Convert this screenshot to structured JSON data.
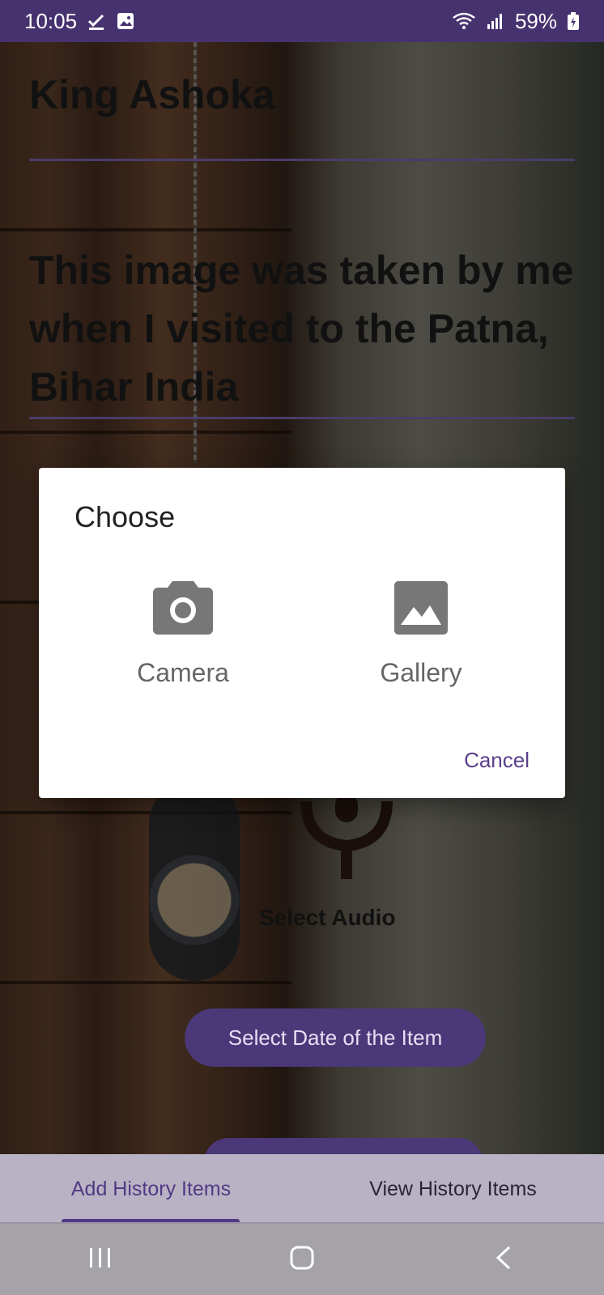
{
  "status_bar": {
    "time": "10:05",
    "battery": "59%",
    "icons": [
      "check-download-icon",
      "image-notification-icon",
      "wifi-icon",
      "signal-icon",
      "battery-charging-icon"
    ]
  },
  "form": {
    "title_value": "King Ashoka",
    "description_value": "This image was taken by me when I visited to the Patna, Bihar India",
    "select_audio_label": "Select Audio",
    "select_date_label": "Select Date of the Item"
  },
  "dialog": {
    "title": "Choose",
    "camera_label": "Camera",
    "gallery_label": "Gallery",
    "cancel_label": "Cancel"
  },
  "tabs": [
    {
      "label": "Add History Items",
      "active": true
    },
    {
      "label": "View History Items",
      "active": false
    }
  ],
  "colors": {
    "primary": "#4b3878",
    "status_bar": "#46326f",
    "accent_text": "#5a3f8c"
  }
}
